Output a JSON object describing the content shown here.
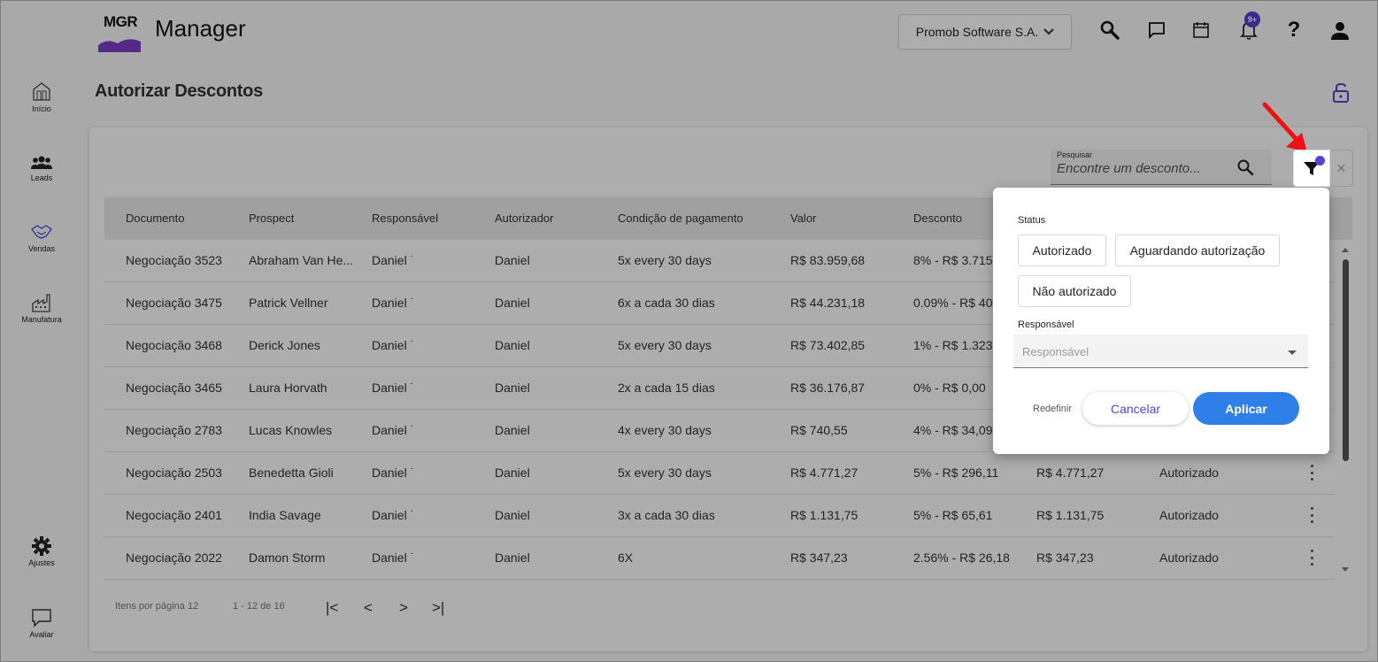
{
  "app": {
    "logo_text": "MGR",
    "title": "Manager",
    "company": "Promob Software S.A.",
    "notification_badge": "9+",
    "accent_color": "#5a3fd0"
  },
  "topbar_icons": [
    "search-icon",
    "chat-icon",
    "calendar-icon",
    "bell-icon",
    "help-icon",
    "user-icon"
  ],
  "sidebar": {
    "items": [
      {
        "label": "Início",
        "icon": "home-icon"
      },
      {
        "label": "Leads",
        "icon": "people-icon"
      },
      {
        "label": "Vendas",
        "icon": "handshake-icon"
      },
      {
        "label": "Manufatura",
        "icon": "factory-icon"
      },
      {
        "label": "Ajustes",
        "icon": "gear-icon"
      },
      {
        "label": "Avaliar",
        "icon": "feedback-icon"
      }
    ]
  },
  "page": {
    "title": "Autorizar Descontos"
  },
  "search": {
    "label": "Pesquisar",
    "placeholder": "Encontre um desconto..."
  },
  "table": {
    "columns": [
      "Documento",
      "Prospect",
      "Responsável",
      "Autorizador",
      "Condição de pagamento",
      "Valor",
      "Desconto"
    ],
    "rows": [
      {
        "doc": "Negociação 3523",
        "prospect": "Abraham Van He...",
        "resp": "Daniel ˙",
        "autorizador": "Daniel",
        "cond": "5x every 30 days",
        "valor": "R$ 83.959,68",
        "desconto": "8% - R$ 3.715,",
        "total": "",
        "status": ""
      },
      {
        "doc": "Negociação 3475",
        "prospect": "Patrick Vellner",
        "resp": "Daniel ˙",
        "autorizador": "Daniel",
        "cond": "6x a cada 30 dias",
        "valor": "R$ 44.231,18",
        "desconto": "0.09% - R$ 40,",
        "total": "",
        "status": ""
      },
      {
        "doc": "Negociação 3468",
        "prospect": "Derick Jones",
        "resp": "Daniel ˙",
        "autorizador": "Daniel",
        "cond": "5x every 30 days",
        "valor": "R$ 73.402,85",
        "desconto": "1% - R$ 1.323,",
        "total": "",
        "status": ""
      },
      {
        "doc": "Negociação 3465",
        "prospect": "Laura Horvath",
        "resp": "Daniel ˙",
        "autorizador": "Daniel",
        "cond": "2x a cada 15 dias",
        "valor": "R$ 36.176,87",
        "desconto": "0% - R$ 0,00",
        "total": "",
        "status": ""
      },
      {
        "doc": "Negociação 2783",
        "prospect": "Lucas Knowles",
        "resp": "Daniel ˙",
        "autorizador": "Daniel",
        "cond": "4x every 30 days",
        "valor": "R$ 740,55",
        "desconto": "4% - R$ 34,09",
        "total": "",
        "status": ""
      },
      {
        "doc": "Negociação 2503",
        "prospect": "Benedetta Gioli",
        "resp": "Daniel ˙",
        "autorizador": "Daniel",
        "cond": "5x every 30 days",
        "valor": "R$ 4.771,27",
        "desconto": "5% - R$ 296,11",
        "total": "R$ 4.771,27",
        "status": "Autorizado"
      },
      {
        "doc": "Negociação 2401",
        "prospect": "India Savage",
        "resp": "Daniel ˙",
        "autorizador": "Daniel",
        "cond": "3x a cada 30 dias",
        "valor": "R$ 1.131,75",
        "desconto": "5% - R$ 65,61",
        "total": "R$ 1.131,75",
        "status": "Autorizado"
      },
      {
        "doc": "Negociação 2022",
        "prospect": "Damon Storm",
        "resp": "Daniel ˙",
        "autorizador": "Daniel",
        "cond": "6X",
        "valor": "R$ 347,23",
        "desconto": "2.56% - R$ 26,18",
        "total": "R$ 347,23",
        "status": "Autorizado"
      }
    ]
  },
  "pagination": {
    "items_per_page": "Itens por página 12",
    "range": "1 - 12 de 16"
  },
  "filter": {
    "status_label": "Status",
    "chips": [
      "Autorizado",
      "Aguardando autorização",
      "Não autorizado"
    ],
    "responsavel_label": "Responsável",
    "responsavel_placeholder": "Responsável",
    "reset": "Redefinir",
    "cancel": "Cancelar",
    "apply": "Aplicar"
  }
}
